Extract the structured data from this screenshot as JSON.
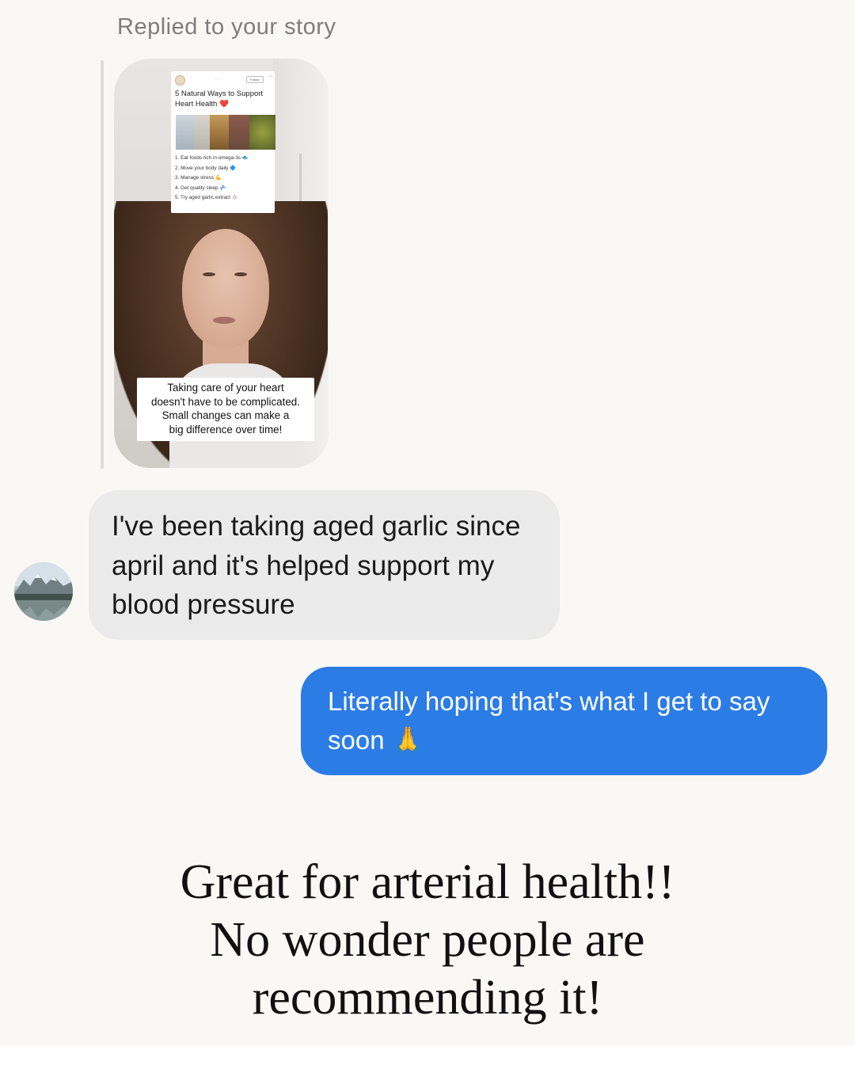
{
  "header": {
    "replied_label": "Replied to your story"
  },
  "story": {
    "card": {
      "follow_label": "Follow",
      "more_label": "···",
      "title_line1": "5 Natural Ways to Support",
      "title_line2": "Heart Health ❤️",
      "items": [
        "1. Eat foods rich in omega-3s 🐟",
        "2. Move your body daily 🔷",
        "3. Manage stress 💪",
        "4. Get quality sleep 💤",
        "5. Try aged garlic extract 🧄"
      ]
    },
    "caption_lines": [
      "Taking care of your heart",
      "doesn't have to be complicated.",
      "Small changes can make a",
      "big difference over time!"
    ]
  },
  "messages": {
    "incoming": {
      "lines": [
        "I've been taking aged garlic since",
        "april and it's helped support my",
        "blood pressure"
      ]
    },
    "outgoing": {
      "lines": [
        "Literally hoping that's what I get to say",
        "soon 🙏"
      ]
    }
  },
  "overlay": {
    "lines": [
      "Great for arterial health!!",
      "No wonder people are",
      "recommending it!"
    ]
  },
  "colors": {
    "background": "#f9f8f5",
    "incoming_bubble": "#ebebeb",
    "outgoing_bubble": "#2c7ce6"
  }
}
